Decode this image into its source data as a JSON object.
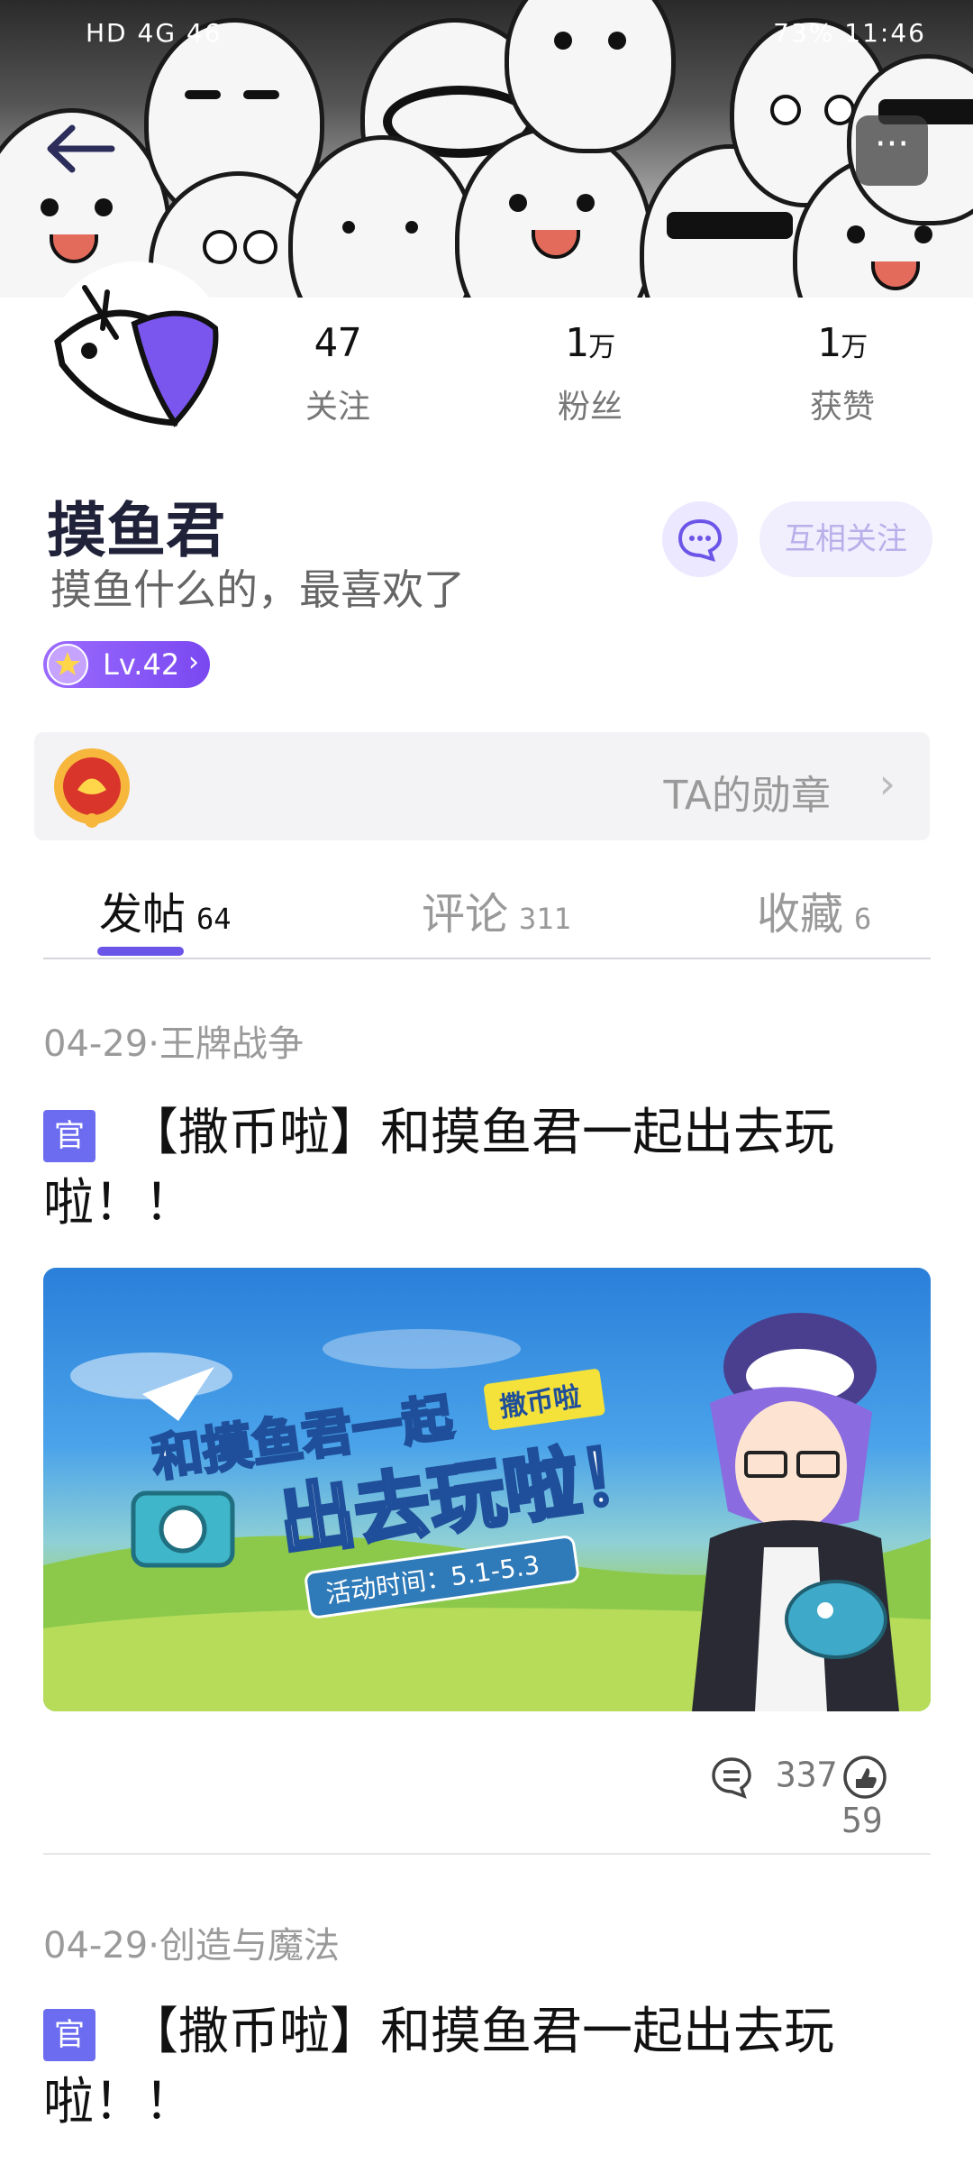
{
  "status_bar": {
    "left": "HD 4G 46",
    "right": "73% 11:46"
  },
  "header": {
    "back_icon": "arrow-left-icon",
    "more_label": "···"
  },
  "profile": {
    "name": "摸鱼君",
    "bio": "摸鱼什么的，最喜欢了",
    "stats": [
      {
        "num": "47",
        "unit": "",
        "label": "关注"
      },
      {
        "num": "1",
        "unit": "万",
        "label": "粉丝"
      },
      {
        "num": "1",
        "unit": "万",
        "label": "获赞"
      }
    ],
    "chat_icon": "chat-bubble-icon",
    "follow_label": "互相关注",
    "level_label": "Lv.42",
    "level_chevron": "›"
  },
  "medals": {
    "label": "TA的勋章",
    "chevron": "›"
  },
  "tabs": [
    {
      "label": "发帖",
      "count": "64"
    },
    {
      "label": "评论",
      "count": "311"
    },
    {
      "label": "收藏",
      "count": "6"
    }
  ],
  "posts": [
    {
      "meta": "04-29·王牌战争",
      "tag": "官",
      "title": "【撒币啦】和摸鱼君一起出去玩啦！！",
      "image": {
        "headline1": "和摸鱼君一起",
        "badge": "撒币啦",
        "headline2": "出去玩啦！",
        "time": "活动时间：5.1-5.3"
      },
      "comments": "337",
      "likes": "59"
    },
    {
      "meta": "04-29·创造与魔法",
      "tag": "官",
      "title": "【撒币啦】和摸鱼君一起出去玩啦！！"
    }
  ],
  "colors": {
    "accent": "#6b55e8",
    "official_tag": "#6c6cf0",
    "banner_dark": "#1a1a1a"
  }
}
